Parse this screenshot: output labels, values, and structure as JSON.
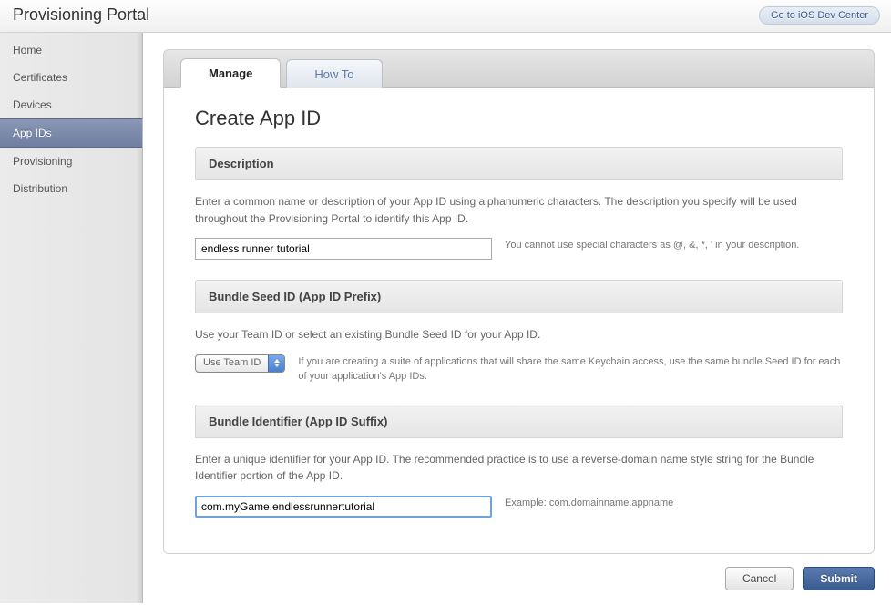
{
  "header": {
    "title": "Provisioning Portal",
    "dev_center_link": "Go to iOS Dev Center"
  },
  "sidebar": {
    "items": [
      {
        "label": "Home",
        "active": false
      },
      {
        "label": "Certificates",
        "active": false
      },
      {
        "label": "Devices",
        "active": false
      },
      {
        "label": "App IDs",
        "active": true
      },
      {
        "label": "Provisioning",
        "active": false
      },
      {
        "label": "Distribution",
        "active": false
      }
    ]
  },
  "tabs": [
    {
      "label": "Manage",
      "active": true
    },
    {
      "label": "How To",
      "active": false
    }
  ],
  "page": {
    "title": "Create App ID",
    "sections": {
      "description": {
        "header": "Description",
        "help": "Enter a common name or description of your App ID using alphanumeric characters. The description you specify will be used throughout the Provisioning Portal to identify this App ID.",
        "value": "endless runner tutorial",
        "hint": "You cannot use special characters as @, &, *, ' in your description."
      },
      "bundle_seed": {
        "header": "Bundle Seed ID (App ID Prefix)",
        "help": "Use your Team ID or select an existing Bundle Seed ID for your App ID.",
        "select_value": "Use Team ID",
        "hint": "If you are creating a suite of applications that will share the same Keychain access, use the same bundle Seed ID for each of your application's App IDs."
      },
      "bundle_identifier": {
        "header": "Bundle Identifier (App ID Suffix)",
        "help": "Enter a unique identifier for your App ID. The recommended practice is to use a reverse-domain name style string for the Bundle Identifier portion of the App ID.",
        "value": "com.myGame.endlessrunnertutorial",
        "hint": "Example: com.domainname.appname"
      }
    },
    "buttons": {
      "cancel": "Cancel",
      "submit": "Submit"
    }
  }
}
